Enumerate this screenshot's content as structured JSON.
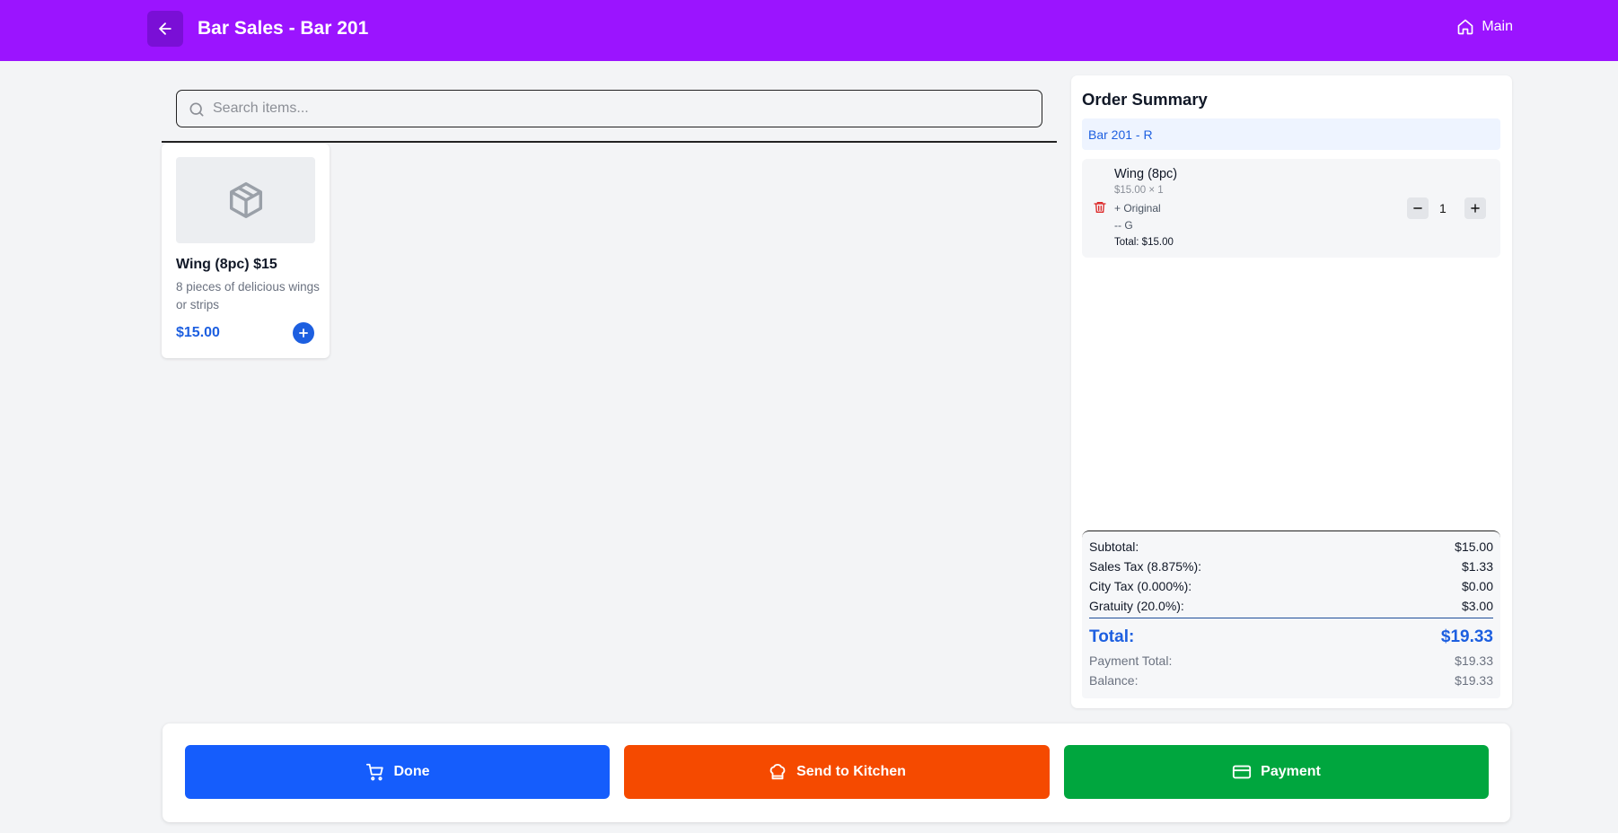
{
  "header": {
    "title": "Bar Sales - Bar 201",
    "main_label": "Main",
    "icons": {
      "back": "arrow-left-icon",
      "home": "home-icon"
    },
    "background_color": "#9b14ff"
  },
  "search": {
    "placeholder": "Search items...",
    "value": ""
  },
  "products": [
    {
      "name": "Wing (8pc) $15",
      "description": "8 pieces of delicious wings or strips",
      "price": "$15.00",
      "icon": "package-icon"
    }
  ],
  "order_summary": {
    "title": "Order Summary",
    "table_label": "Bar 201  - R",
    "items": [
      {
        "name": "Wing (8pc)",
        "price_qty": "$15.00 × 1",
        "modifiers": [
          "+ Original",
          "-- G"
        ],
        "total": "Total: $15.00",
        "quantity": "1"
      }
    ],
    "totals": {
      "subtotal_label": "Subtotal:",
      "subtotal": "$15.00",
      "sales_tax_label": "Sales Tax (8.875%):",
      "sales_tax": "$1.33",
      "city_tax_label": "City Tax (0.000%):",
      "city_tax": "$0.00",
      "gratuity_label": "Gratuity (20.0%):",
      "gratuity": "$3.00",
      "total_label": "Total:",
      "total": "$19.33",
      "payment_total_label": "Payment Total:",
      "payment_total": "$19.33",
      "balance_label": "Balance:",
      "balance": "$19.33"
    }
  },
  "actions": {
    "done_label": "Done",
    "kitchen_label": "Send to Kitchen",
    "payment_label": "Payment",
    "colors": {
      "done": "#155dfc",
      "kitchen": "#f54a00",
      "payment": "#00a63e"
    }
  }
}
